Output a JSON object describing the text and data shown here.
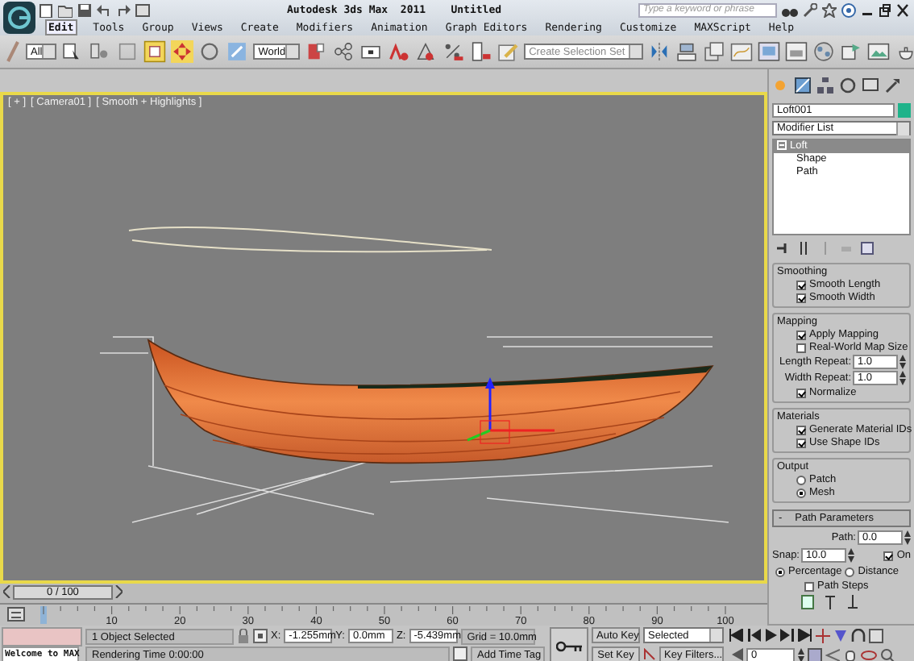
{
  "title_bar": {
    "title": "Autodesk 3ds Max  2011    Untitled",
    "search": {
      "placeholder": "Type a keyword or phrase"
    }
  },
  "menu": [
    {
      "label": "Edit",
      "selected": true
    },
    {
      "label": "Tools",
      "selected": false
    },
    {
      "label": "Group",
      "selected": false
    },
    {
      "label": "Views",
      "selected": false
    },
    {
      "label": "Create",
      "selected": false
    },
    {
      "label": "Modifiers",
      "selected": false
    },
    {
      "label": "Animation",
      "selected": false
    },
    {
      "label": "Graph Editors",
      "selected": false
    },
    {
      "label": "Rendering",
      "selected": false
    },
    {
      "label": "Customize",
      "selected": false
    },
    {
      "label": "MAXScript",
      "selected": false
    },
    {
      "label": "Help",
      "selected": false
    }
  ],
  "toolbar": {
    "selection_filter": "All",
    "reference_coord": "World",
    "selection_set": {
      "placeholder": "Create Selection Set"
    }
  },
  "viewport": {
    "labels": [
      "[ + ]",
      "[ Camera01 ]",
      "[ Smooth + Highlights ]"
    ],
    "active": true
  },
  "command_panel": {
    "object_name": "Loft001",
    "modifier_list": "Modifier List",
    "stack": [
      {
        "label": "Loft",
        "selected": true,
        "expanded": true,
        "children": [
          {
            "label": "Shape",
            "selected": false
          },
          {
            "label": "Path",
            "selected": false
          }
        ]
      }
    ],
    "skin_groups": [
      {
        "title": "Smoothing",
        "items": [
          {
            "kind": "checkbox",
            "label": "Smooth Length",
            "checked": true
          },
          {
            "kind": "checkbox",
            "label": "Smooth Width",
            "checked": true
          }
        ]
      },
      {
        "title": "Mapping",
        "items": [
          {
            "kind": "checkbox",
            "label": "Apply Mapping",
            "checked": true
          },
          {
            "kind": "checkbox",
            "label": "Real-World Map Size",
            "checked": false
          },
          {
            "kind": "spinner",
            "label": "Length Repeat:",
            "value": "1.0"
          },
          {
            "kind": "spinner",
            "label": "Width Repeat:",
            "value": "1.0"
          },
          {
            "kind": "checkbox",
            "label": "Normalize",
            "checked": true
          }
        ]
      },
      {
        "title": "Materials",
        "items": [
          {
            "kind": "checkbox",
            "label": "Generate Material IDs",
            "checked": true
          },
          {
            "kind": "checkbox",
            "label": "Use Shape IDs",
            "checked": true
          }
        ]
      },
      {
        "title": "Output",
        "items": [
          {
            "kind": "radio",
            "label": "Patch",
            "selected": false
          },
          {
            "kind": "radio",
            "label": "Mesh",
            "selected": true
          }
        ]
      }
    ],
    "path_parameters": {
      "sign": "-",
      "title": "Path Parameters",
      "path": {
        "label": "Path:",
        "value": "0.0"
      },
      "snap": {
        "label": "Snap:",
        "value": "10.0"
      },
      "snap_on": {
        "label": "On",
        "checked": true
      },
      "modes": [
        {
          "label": "Percentage",
          "selected": true
        },
        {
          "label": "Distance",
          "selected": false
        }
      ],
      "path_steps": {
        "label": "Path Steps",
        "checked": false
      }
    }
  },
  "time_slider": {
    "label": "0 / 100",
    "level": 0
  },
  "track_bar": {
    "labels": [
      "10",
      "20",
      "30",
      "40",
      "50",
      "60",
      "70",
      "80",
      "90",
      "100"
    ]
  },
  "status": {
    "listener": "Welcome to MAX",
    "prompt": "1 Object Selected",
    "hint": "Rendering Time  0:00:00",
    "x": {
      "label": "X:",
      "value": "-1.255mm"
    },
    "y": {
      "label": "Y:",
      "value": "0.0mm"
    },
    "z": {
      "label": "Z:",
      "value": "-5.439mm"
    },
    "grid": "Grid = 10.0mm",
    "add_time_tag": "Add Time Tag"
  },
  "animation": {
    "auto_key": "Auto Key",
    "key_mode": "Selected",
    "set_key": "Set Key",
    "key_filters": "Key Filters...",
    "frame": "0"
  }
}
